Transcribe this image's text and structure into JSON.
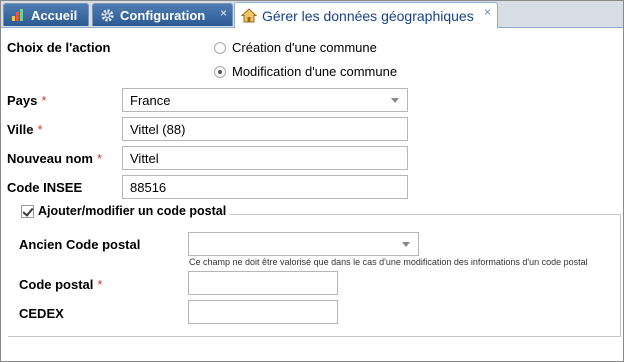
{
  "tabs": [
    {
      "label": "Accueil",
      "icon": "bar-chart-icon",
      "closable": false
    },
    {
      "label": "Configuration",
      "icon": "gear-icon",
      "closable": true
    },
    {
      "label": "Gérer les données géographiques",
      "icon": "home-icon",
      "closable": true,
      "active": true
    }
  ],
  "tab_close_glyph": "×",
  "form": {
    "action_label": "Choix de l'action",
    "actions": [
      {
        "label": "Création d'une commune",
        "selected": false
      },
      {
        "label": "Modification d'une commune",
        "selected": true
      }
    ],
    "pays": {
      "label": "Pays",
      "value": "France"
    },
    "ville": {
      "label": "Ville",
      "value": "Vittel (88)"
    },
    "nouveau_nom": {
      "label": "Nouveau nom",
      "value": "Vittel"
    },
    "code_insee": {
      "label": "Code INSEE",
      "value": "88516"
    },
    "required_mark": "*"
  },
  "postal": {
    "legend": "Ajouter/modifier un code postal",
    "checked": true,
    "ancien": {
      "label": "Ancien Code postal",
      "value": ""
    },
    "hint": "Ce champ ne doit être valorisé que dans le cas d'une modification des informations d'un code postal",
    "code_postal": {
      "label": "Code postal",
      "value": ""
    },
    "cedex": {
      "label": "CEDEX",
      "value": ""
    }
  },
  "colors": {
    "tab_active_text": "#15428b",
    "required": "#d13a2b",
    "tab_dark": "#2c5a94"
  }
}
